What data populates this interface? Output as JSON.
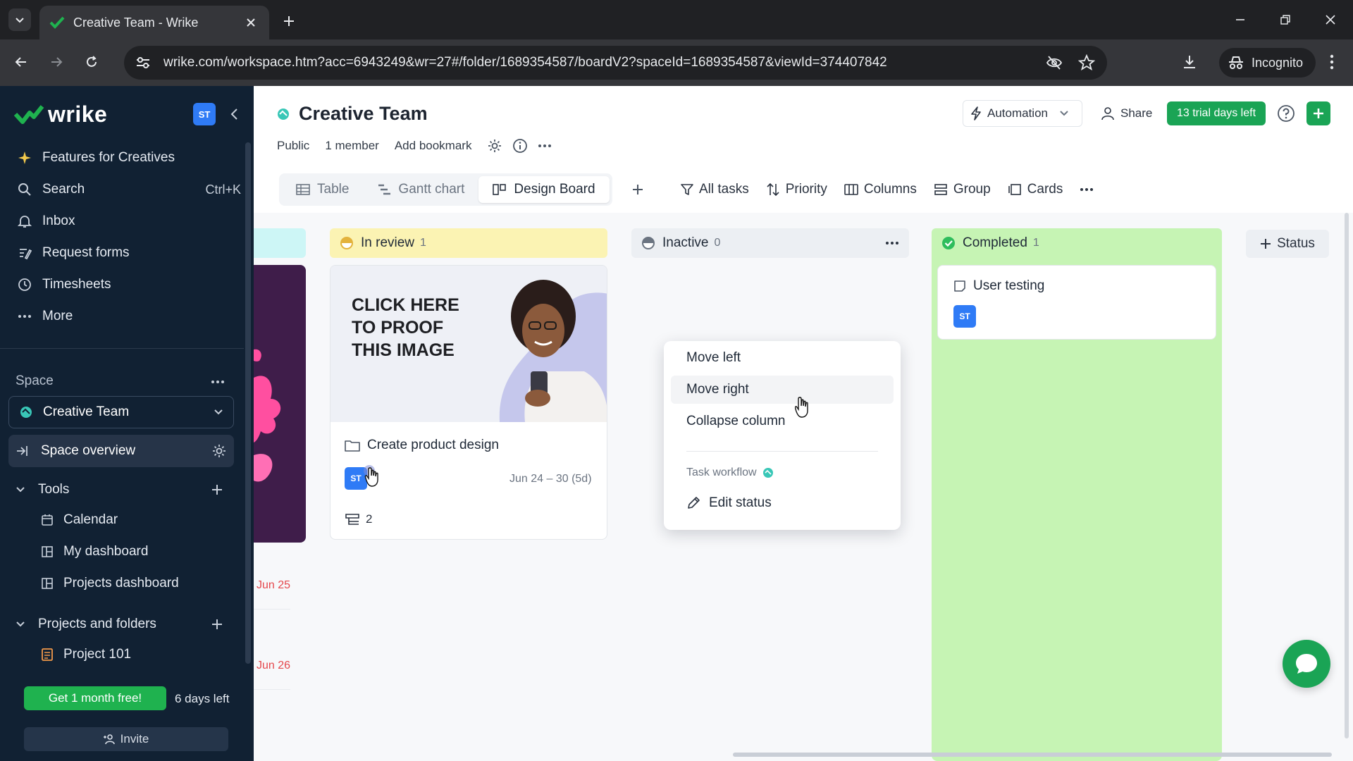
{
  "browser": {
    "tab_title": "Creative Team - Wrike",
    "url": "wrike.com/workspace.htm?acc=6943249&wr=27#/folder/1689354587/boardV2?spaceId=1689354587&viewId=374407842",
    "incognito_label": "Incognito"
  },
  "sidebar": {
    "logo_text": "wrike",
    "user_badge": "ST",
    "nav": [
      {
        "label": "Features for Creatives",
        "icon": "sparkle-icon"
      },
      {
        "label": "Search",
        "icon": "search-icon",
        "shortcut": "Ctrl+K"
      },
      {
        "label": "Inbox",
        "icon": "bell-icon"
      },
      {
        "label": "Request forms",
        "icon": "form-icon"
      },
      {
        "label": "Timesheets",
        "icon": "clock-icon"
      },
      {
        "label": "More",
        "icon": "dots-icon"
      }
    ],
    "space_label": "Space",
    "space_name": "Creative Team",
    "space_overview": "Space overview",
    "tools_label": "Tools",
    "tools": [
      {
        "label": "Calendar",
        "icon": "calendar-icon"
      },
      {
        "label": "My dashboard",
        "icon": "dashboard-icon"
      },
      {
        "label": "Projects dashboard",
        "icon": "dashboard-icon"
      }
    ],
    "projects_label": "Projects and folders",
    "projects": [
      {
        "label": "Project 101",
        "icon": "project-icon"
      }
    ],
    "promo_button": "Get 1 month free!",
    "days_left": "6 days left",
    "invite": "Invite"
  },
  "header": {
    "title": "Creative Team",
    "visibility": "Public",
    "members": "1 member",
    "bookmark": "Add bookmark",
    "automation": "Automation",
    "share": "Share",
    "trial": "13 trial days left"
  },
  "views": {
    "tabs": [
      {
        "label": "Table",
        "active": false
      },
      {
        "label": "Gantt chart",
        "active": false
      },
      {
        "label": "Design Board",
        "active": true
      }
    ],
    "tools": [
      "All tasks",
      "Priority",
      "Columns",
      "Group",
      "Cards"
    ]
  },
  "board": {
    "left_dates": [
      "Jun 25",
      "Jun 26"
    ],
    "columns": [
      {
        "name": "In review",
        "count": "1",
        "color": "#fbf3b3",
        "status_color": "#f2c94c"
      },
      {
        "name": "Inactive",
        "count": "0",
        "color": "#eceff3",
        "status_color": "#8a939e"
      },
      {
        "name": "Completed",
        "count": "1",
        "color": "#c6f4b4",
        "status_color": "#2ebd5c"
      }
    ],
    "in_review_card": {
      "image_text": "CLICK HERE\nTO PROOF\nTHIS IMAGE",
      "title": "Create product design",
      "assignee": "ST",
      "dates": "Jun 24 – 30 (5d)",
      "subtasks": "2"
    },
    "completed_card": {
      "title": "User testing",
      "assignee": "ST"
    },
    "add_status": "Status"
  },
  "context_menu": {
    "items": [
      "Move left",
      "Move right",
      "Collapse column"
    ],
    "hovered": "Move right",
    "section": "Task workflow",
    "edit": "Edit status"
  },
  "colors": {
    "sidebar_bg": "#112133",
    "brand_green": "#1aa455",
    "accent_blue": "#2f7bf6"
  }
}
